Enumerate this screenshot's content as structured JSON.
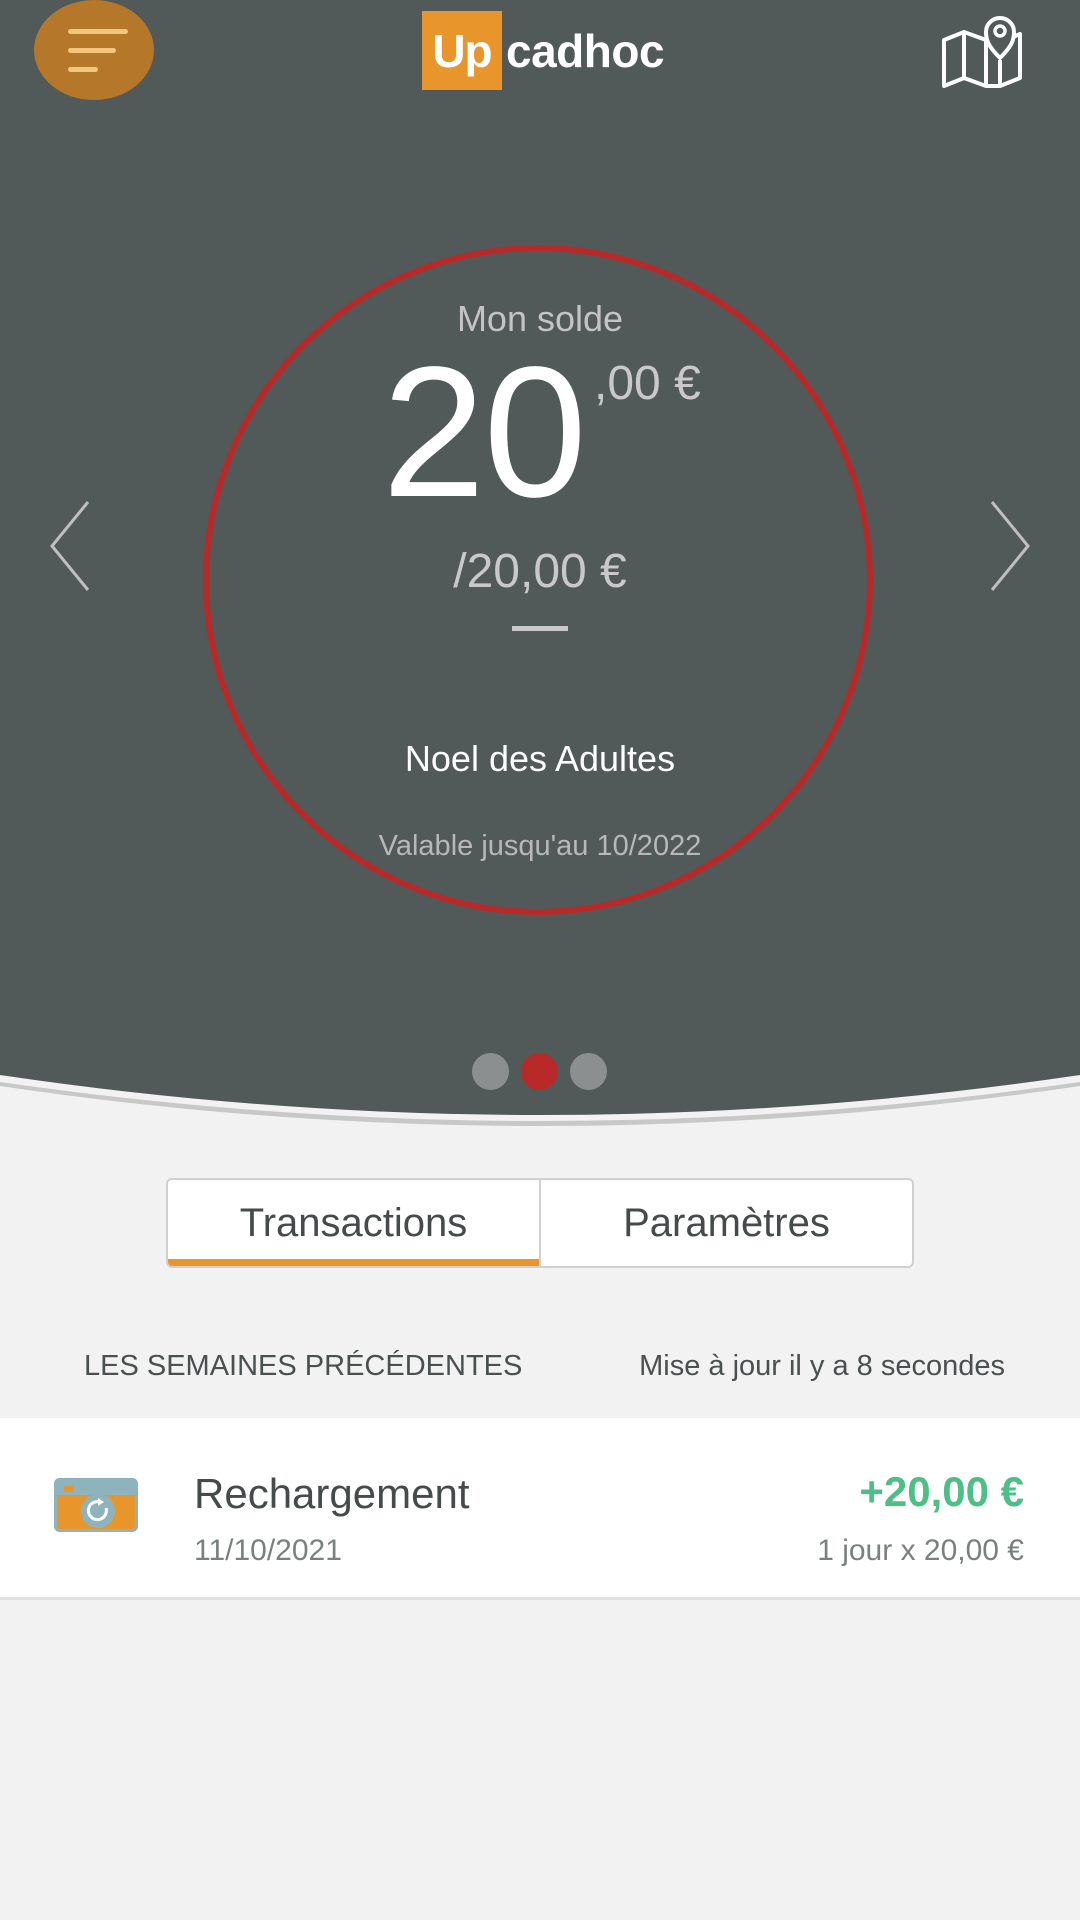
{
  "header": {
    "logo_mark": "Up",
    "logo_text": "cadhoc"
  },
  "balance": {
    "label": "Mon solde",
    "amount_integer": "20",
    "amount_decimal": ",00 €",
    "amount_total": "/20,00 €",
    "card_name": "Noel des Adultes",
    "validity": "Valable jusqu'au 10/2022"
  },
  "carousel": {
    "dots": 3,
    "active_index": 1
  },
  "tabs": [
    {
      "label": "Transactions",
      "active": true
    },
    {
      "label": "Paramètres",
      "active": false
    }
  ],
  "transactions_section": {
    "title": "LES SEMAINES PRÉCÉDENTES",
    "updated": "Mise à jour il y a 8 secondes"
  },
  "transactions": [
    {
      "title": "Rechargement",
      "date": "11/10/2021",
      "amount": "+20,00 €",
      "detail": "1 jour x 20,00 €"
    }
  ],
  "colors": {
    "hero_bg": "#515959",
    "accent_orange": "#e8952c",
    "ring_red": "#b82a2a",
    "positive_green": "#4dbf86"
  }
}
